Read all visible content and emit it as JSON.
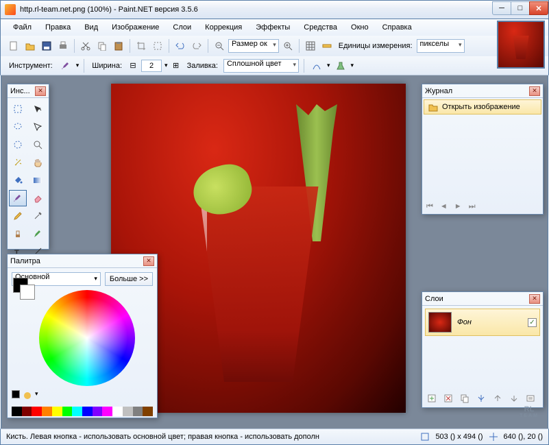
{
  "title": "http.rl-team.net.png (100%) - Paint.NET версия 3.5.6",
  "menu": [
    "Файл",
    "Правка",
    "Вид",
    "Изображение",
    "Слои",
    "Коррекция",
    "Эффекты",
    "Средства",
    "Окно",
    "Справка"
  ],
  "toolbar": {
    "zoom_label": "Размер ок",
    "units_label": "Единицы измерения:",
    "units_value": "пикселы"
  },
  "tooloptions": {
    "tool_label": "Инструмент:",
    "width_label": "Ширина:",
    "width_value": "2",
    "fill_label": "Заливка:",
    "fill_value": "Сплошной цвет"
  },
  "toolbox": {
    "title": "Инс..."
  },
  "palette": {
    "title": "Палитра",
    "mode": "Основной",
    "more": "Больше >>",
    "strip": [
      "#000",
      "#404040",
      "#ff0000",
      "#ff8000",
      "#ffff00",
      "#00ff00",
      "#00ffff",
      "#0000ff",
      "#8000ff",
      "#ff00ff",
      "#803000",
      "#ffffff",
      "#c0c0c0",
      "#ff8080",
      "#ffc080",
      "#ffff80",
      "#80ff80"
    ]
  },
  "history": {
    "title": "Журнал",
    "item": "Открыть изображение"
  },
  "layers": {
    "title": "Слои",
    "bg": "Фон"
  },
  "status": {
    "text": "Кисть. Левая кнопка - использовать основной цвет; правая кнопка - использовать дополн",
    "size": "503 () x 494 ()",
    "pos": "640 (), 20 ()"
  },
  "watermark": "RL",
  "watermark_sub": "TEAM"
}
